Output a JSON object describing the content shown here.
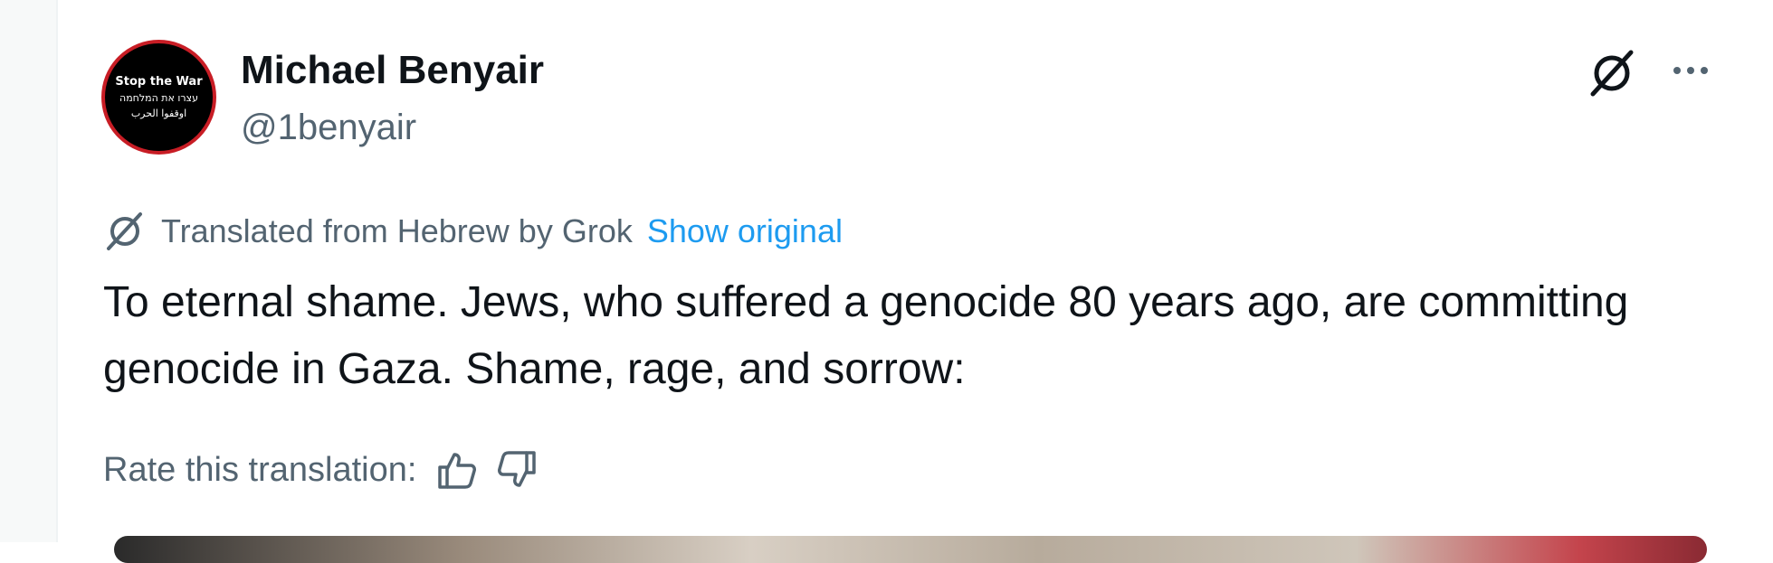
{
  "post": {
    "author": {
      "display_name": "Michael Benyair",
      "handle": "@1benyair",
      "avatar": {
        "line1": "Stop the War",
        "line2": "עצרו את המלחמה",
        "line3": "اوقفوا الحرب",
        "background_color": "#000000",
        "border_color": "#c81d25"
      }
    },
    "header_actions": {
      "grok_icon": "grok-icon",
      "more_icon": "more-icon"
    },
    "translation": {
      "icon": "grok-icon",
      "label": "Translated from Hebrew by Grok",
      "show_original": "Show original"
    },
    "text": "To eternal shame. Jews, who suffered a genocide 80 years ago, are committing genocide in Gaza. Shame, rage, and sorrow:",
    "rate": {
      "label": "Rate this translation:",
      "thumbs_up_icon": "thumbs-up-icon",
      "thumbs_down_icon": "thumbs-down-icon"
    }
  },
  "colors": {
    "text_primary": "#0f1419",
    "text_secondary": "#536471",
    "link": "#1d9bf0"
  }
}
